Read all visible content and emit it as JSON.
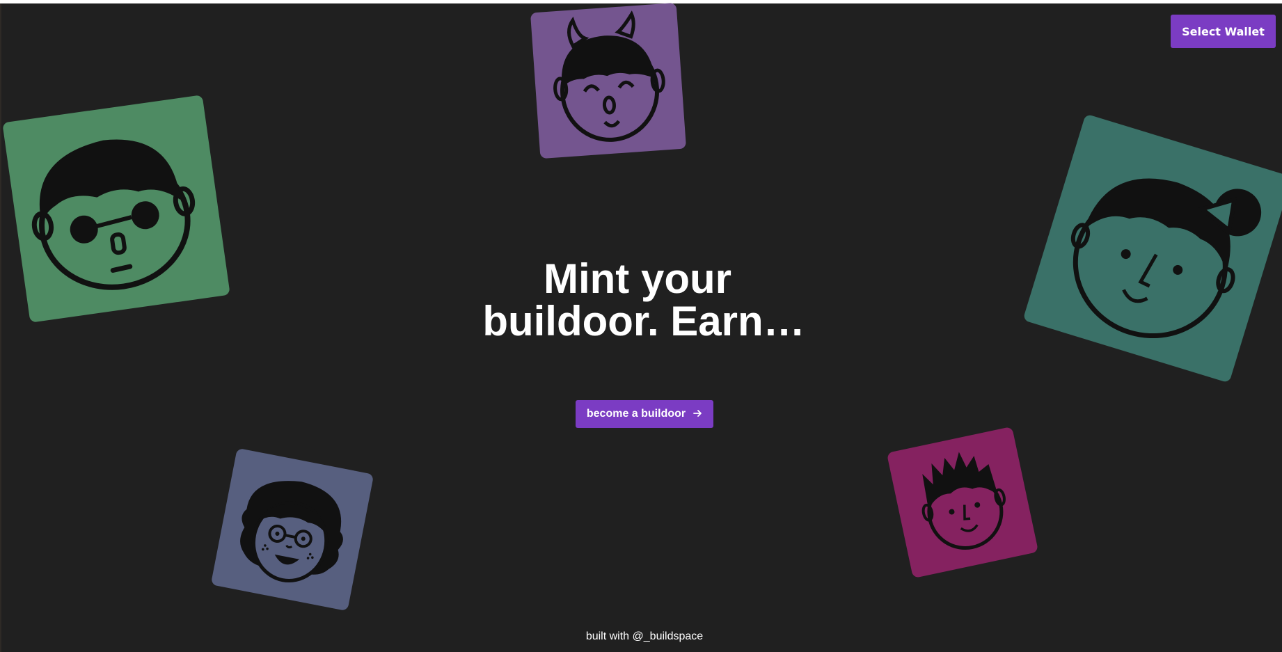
{
  "colors": {
    "background": "#202020",
    "accent": "#7b3cc3",
    "card_green": "#4e8b63",
    "card_purple": "#74558f",
    "card_teal": "#3a7168",
    "card_slate": "#575f7f",
    "card_magenta": "#852260"
  },
  "header": {
    "wallet_button_label": "Select Wallet"
  },
  "hero": {
    "line1": "Mint your",
    "line2": "buildoor. Earn…",
    "cta_label": "become a buildoor",
    "cta_icon": "arrow-right-icon"
  },
  "avatars": [
    {
      "name": "green-avatar-card",
      "color": "#4e8b63",
      "icon": "sunglasses-face-icon"
    },
    {
      "name": "purple-avatar-card",
      "color": "#74558f",
      "icon": "horned-face-icon"
    },
    {
      "name": "teal-avatar-card",
      "color": "#3a7168",
      "icon": "bow-face-icon"
    },
    {
      "name": "slate-avatar-card",
      "color": "#575f7f",
      "icon": "glasses-face-icon"
    },
    {
      "name": "magenta-avatar-card",
      "color": "#852260",
      "icon": "spiky-hair-face-icon"
    }
  ],
  "footer": {
    "prefix": "built with",
    "link_text": "@_buildspace"
  }
}
